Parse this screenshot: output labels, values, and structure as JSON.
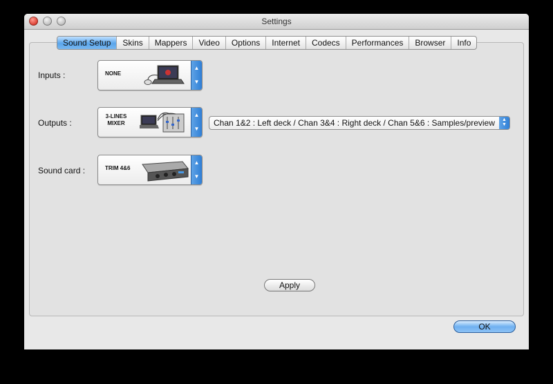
{
  "window": {
    "title": "Settings"
  },
  "tabs": [
    {
      "label": "Sound Setup",
      "active": true
    },
    {
      "label": "Skins"
    },
    {
      "label": "Mappers"
    },
    {
      "label": "Video"
    },
    {
      "label": "Options"
    },
    {
      "label": "Internet"
    },
    {
      "label": "Codecs"
    },
    {
      "label": "Performances"
    },
    {
      "label": "Browser"
    },
    {
      "label": "Info"
    }
  ],
  "inputs": {
    "label": "Inputs :",
    "device": "NONE"
  },
  "outputs": {
    "label": "Outputs :",
    "device_line1": "3-LINES",
    "device_line2": "MIXER",
    "routing": "Chan 1&2 : Left deck / Chan 3&4 : Right deck / Chan 5&6 : Samples/preview"
  },
  "soundcard": {
    "label": "Sound card :",
    "device": "TRIM 4&6"
  },
  "buttons": {
    "apply": "Apply",
    "ok": "OK"
  },
  "colors": {
    "accent": "#4a9be8",
    "close": "#d8372b"
  }
}
